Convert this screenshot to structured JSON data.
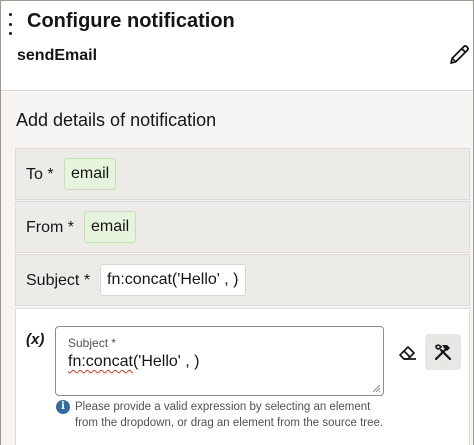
{
  "header": {
    "title": "Configure notification",
    "subtitle": "sendEmail",
    "menu_icon": "kebab-vertical-icon",
    "edit_icon": "pencil-icon"
  },
  "panel": {
    "section_title": "Add details of notification",
    "fields": {
      "to": {
        "label": "To *",
        "value": "email"
      },
      "from": {
        "label": "From *",
        "value": "email"
      },
      "subject": {
        "label": "Subject *",
        "value": "fn:concat('Hello' , )"
      }
    },
    "editor": {
      "fx_label": "(x)",
      "textarea_label": "Subject *",
      "textarea_value_fn": "fn:concat",
      "textarea_value_rest": "('Hello' , )",
      "help_icon": "info-icon",
      "help_text": "Please provide a valid expression by selecting an element from the dropdown, or drag an element from the source tree.",
      "clear_icon": "eraser-icon",
      "tools_icon": "hammer-wrench-icon"
    }
  },
  "colors": {
    "pill_bg": "#e6f4dd",
    "panel_bg": "#f5f4f2",
    "row_bg": "#ecebe8",
    "info_blue": "#2f6ea5",
    "spell_error": "#d63b25"
  }
}
